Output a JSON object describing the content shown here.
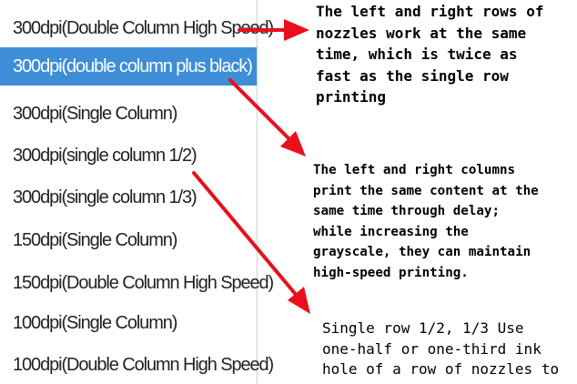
{
  "dropdown": {
    "selected_index": 1,
    "options": [
      "300dpi(Double Column High Speed)",
      "300dpi(double column plus black)",
      "300dpi(Single Column)",
      "300dpi(single column 1/2)",
      "300dpi(single column 1/3)",
      "150dpi(Single Column)",
      "150dpi(Double Column High Speed)",
      "100dpi(Single Column)",
      "100dpi(Double Column High Speed)"
    ]
  },
  "annotations": [
    {
      "text": "The left and right rows of\nnozzles work at the same\ntime, which is twice as\nfast as the single row\nprinting"
    },
    {
      "text": "The left and right columns\nprint the same content at the\nsame time through delay;\nwhile increasing the\ngrayscale, they can maintain\nhigh-speed printing."
    },
    {
      "text": "Single row 1/2, 1/3 Use\none-half or one-third ink\nhole of a row of nozzles to"
    }
  ],
  "colors": {
    "selected_bg": "#3d8ed6",
    "arrow": "#e8101a"
  },
  "icons": [
    "arrow-right-icon",
    "arrow-down-right-icon",
    "arrow-down-right-icon"
  ]
}
